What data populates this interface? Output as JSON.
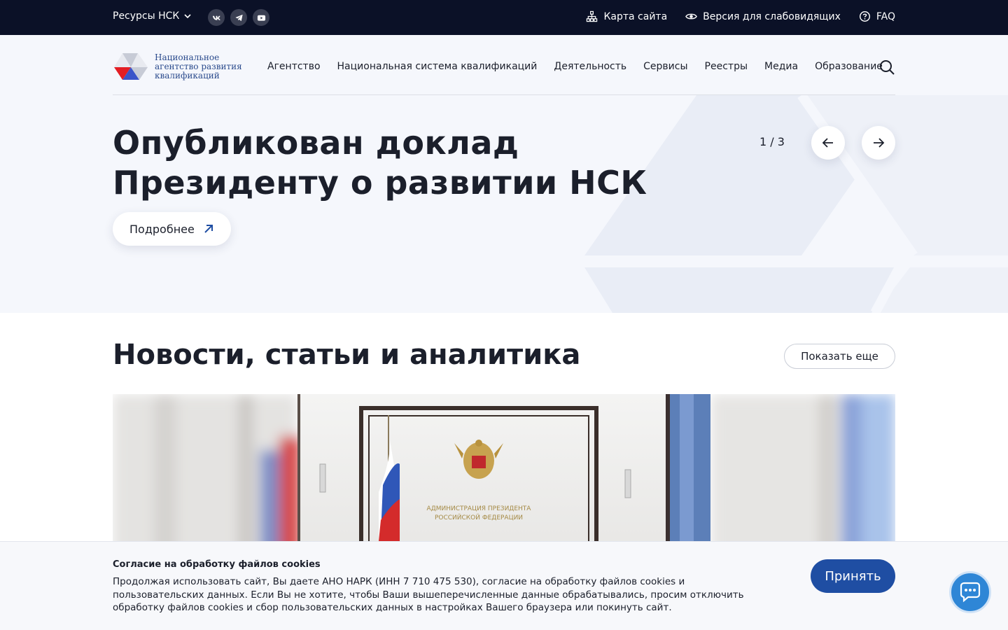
{
  "topbar": {
    "resources_label": "Ресурсы НСК",
    "social": [
      "vk-icon",
      "telegram-icon",
      "youtube-icon"
    ],
    "sitemap_label": "Карта сайта",
    "accessibility_label": "Версия для слабовидящих",
    "faq_label": "FAQ"
  },
  "header": {
    "logo_text": "Национальное агентство развития квалификаций",
    "nav": [
      "Агентство",
      "Национальная система квалификаций",
      "Деятельность",
      "Сервисы",
      "Реестры",
      "Медиа",
      "Образование"
    ]
  },
  "hero": {
    "title": "Опубликован доклад Президенту о развитии НСК",
    "more_label": "Подробнее",
    "counter": "1 / 3"
  },
  "news": {
    "title": "Новости, статьи и аналитика",
    "show_more_label": "Показать еще",
    "image_sign_line1": "АДМИНИСТРАЦИЯ ПРЕЗИДЕНТА",
    "image_sign_line2": "РОССИЙСКОЙ ФЕДЕРАЦИИ"
  },
  "cookie": {
    "title": "Согласие на обработку файлов cookies",
    "body": "Продолжая использовать сайт, Вы даете АНО НАРК (ИНН 7 710 475 530), согласие на обработку файлов cookies и пользовательских данных. Если Вы не хотите, чтобы Ваши вышеперечисленные данные обрабатывались, просим отключить обработку файлов cookies и сбор пользовательских данных в настройках Вашего браузера или покинуть сайт.",
    "accept_label": "Принять"
  },
  "colors": {
    "topbar_bg": "#0b1127",
    "accent_blue": "#1f4ea3",
    "hero_bg": "#f5f7fc",
    "chat_blue": "#2e86d6"
  }
}
